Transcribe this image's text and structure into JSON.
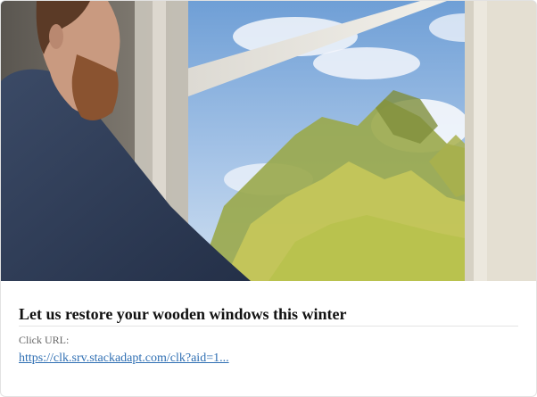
{
  "ad": {
    "title": "Let us restore your wooden windows this winter",
    "click_url_label": "Click URL:",
    "click_url": "https://clk.srv.stackadapt.com/clk?aid=1...",
    "image_alt": "man-looking-out-wooden-window-photo"
  },
  "colors": {
    "title_text": "#111111",
    "label_text": "#666666",
    "link": "#2f6fb3",
    "card_border": "#e2e2e2"
  }
}
